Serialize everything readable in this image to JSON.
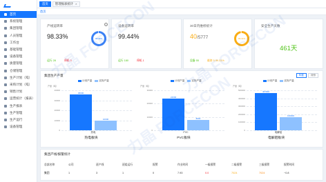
{
  "brand": {
    "accent": "#1677ff",
    "green": "#52c41a",
    "orange": "#faad14",
    "light_blue": "#8ec1ff"
  },
  "sidebar": {
    "items": [
      {
        "label": "首页",
        "icon": "home-icon",
        "active": true
      },
      {
        "label": "系统管理",
        "icon": "gear-icon"
      },
      {
        "label": "集团管理",
        "icon": "building-icon"
      },
      {
        "label": "人员管理",
        "icon": "user-icon"
      },
      {
        "label": "工作台",
        "icon": "desk-icon"
      },
      {
        "label": "基础管理",
        "icon": "grid-icon"
      },
      {
        "label": "设备管理",
        "icon": "device-icon"
      },
      {
        "label": "质量管理",
        "icon": "check-icon"
      },
      {
        "label": "仓储管理",
        "icon": "box-icon"
      },
      {
        "label": "生产计划（吨）",
        "icon": "plan-icon"
      },
      {
        "label": "采购计划（吨）",
        "icon": "cart-icon"
      },
      {
        "label": "销售计划",
        "icon": "chart-icon"
      },
      {
        "label": "运营统计（报表）",
        "icon": "report-icon"
      },
      {
        "label": "生产报表",
        "icon": "doc-icon"
      },
      {
        "label": "生产管理",
        "icon": "factory-icon"
      },
      {
        "label": "生产运行",
        "icon": "run-icon"
      },
      {
        "label": "设备管理",
        "icon": "tool-icon"
      }
    ]
  },
  "topbar": {
    "tabs": [
      {
        "label": "首页",
        "active": true
      },
      {
        "label": "管理报表统计",
        "close": "×"
      }
    ]
  },
  "cards": [
    {
      "title": "产线运转率",
      "value": "98.33%",
      "ring_label": "98.33%",
      "sub_a": "运行 28",
      "sub_b": "停机 0"
    },
    {
      "title": "设备运转率",
      "value": "99.44%",
      "ring_label": "99.44%",
      "sub_a": "运行 180",
      "sub_b": "停机 1"
    },
    {
      "title": "30日内维修统计",
      "value_a": "40",
      "value_b": "/5777",
      "ring_label": "99.31%",
      "sub_a": "设备 55",
      "sub_b": "维修 5 99.31%"
    },
    {
      "title": "安全生产天数",
      "value": "461天"
    }
  ],
  "production": {
    "title": "集团生产产量",
    "buttons": [
      "年度",
      "月份"
    ],
    "legend": [
      "计划产量",
      "实际产量"
    ]
  },
  "chart_data": [
    {
      "type": "bar",
      "title": "热电板块",
      "categories": [
        "热电"
      ],
      "series": [
        {
          "name": "计划产量",
          "values": [
            36000
          ]
        },
        {
          "name": "实际产量",
          "values": [
            10000
          ]
        }
      ],
      "ylim": [
        0,
        40000
      ],
      "yticks": [
        "40000",
        "30000",
        "20000",
        "10000",
        "0"
      ],
      "ylabel": "产量（吨）",
      "bar_labels": [
        "36000",
        "10000"
      ]
    },
    {
      "type": "bar",
      "title": "PVC板块",
      "categories": [
        "PVC"
      ],
      "series": [
        {
          "name": "计划产量",
          "values": [
            24000
          ]
        },
        {
          "name": "实际产量",
          "values": [
            8000
          ]
        }
      ],
      "ylim": [
        0,
        30000
      ],
      "yticks": [
        "30000",
        "20000",
        "10000",
        "0"
      ],
      "ylabel": "产量（吨）",
      "bar_labels": [
        "24000",
        "8000"
      ]
    },
    {
      "type": "bar",
      "title": "电解铝板块",
      "categories": [
        "电解铝"
      ],
      "series": [
        {
          "name": "计划产量",
          "values": [
            467000
          ]
        },
        {
          "name": "实际产量",
          "values": [
            160000
          ]
        }
      ],
      "ylim": [
        0,
        500000
      ],
      "yticks": [
        "500000",
        "400000",
        "300000",
        "200000",
        "100000",
        "0"
      ],
      "ylabel": "产量（吨）",
      "bar_labels": [
        "467000",
        "160000"
      ]
    }
  ],
  "table": {
    "title": "集团产线/报警统计",
    "headers": [
      "总部名称",
      "公司",
      "班产线",
      "班组运行",
      "报警",
      "作业时间",
      "一级报警",
      "二级报警",
      "三级报警",
      "报警时间"
    ],
    "rows": [
      [
        "集团",
        "1",
        "3",
        "1",
        "0",
        "7.93",
        "0.0",
        "7024",
        "7024",
        "~0.8"
      ]
    ]
  }
}
